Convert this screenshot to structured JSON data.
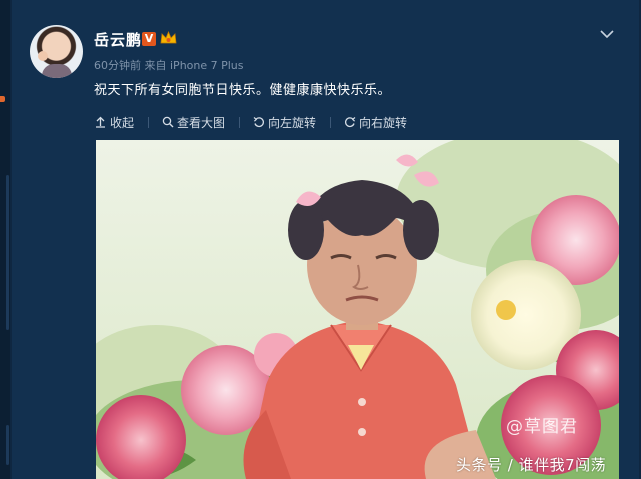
{
  "post": {
    "username": "岳云鹏",
    "verified_badge": "V",
    "timestamp": "60分钟前",
    "source_prefix": "来自",
    "source": "iPhone 7 Plus",
    "text": "祝天下所有女同胞节日快乐。健健康康快快乐乐。"
  },
  "toolbar": {
    "collapse": "收起",
    "view_large": "查看大图",
    "rotate_left": "向左旋转",
    "rotate_right": "向右旋转"
  },
  "image": {
    "watermark": "@草图君",
    "caption": "头条号 / 谁伴我7闯荡"
  },
  "colors": {
    "background": "#0f2741",
    "card": "#12304f",
    "badge": "#e2571e",
    "meta_text": "#7f93aa"
  },
  "icons": {
    "collapse": "arrow-up-icon",
    "view_large": "magnifier-icon",
    "rotate_left": "rotate-left-icon",
    "rotate_right": "rotate-right-icon",
    "menu": "chevron-down-icon"
  }
}
